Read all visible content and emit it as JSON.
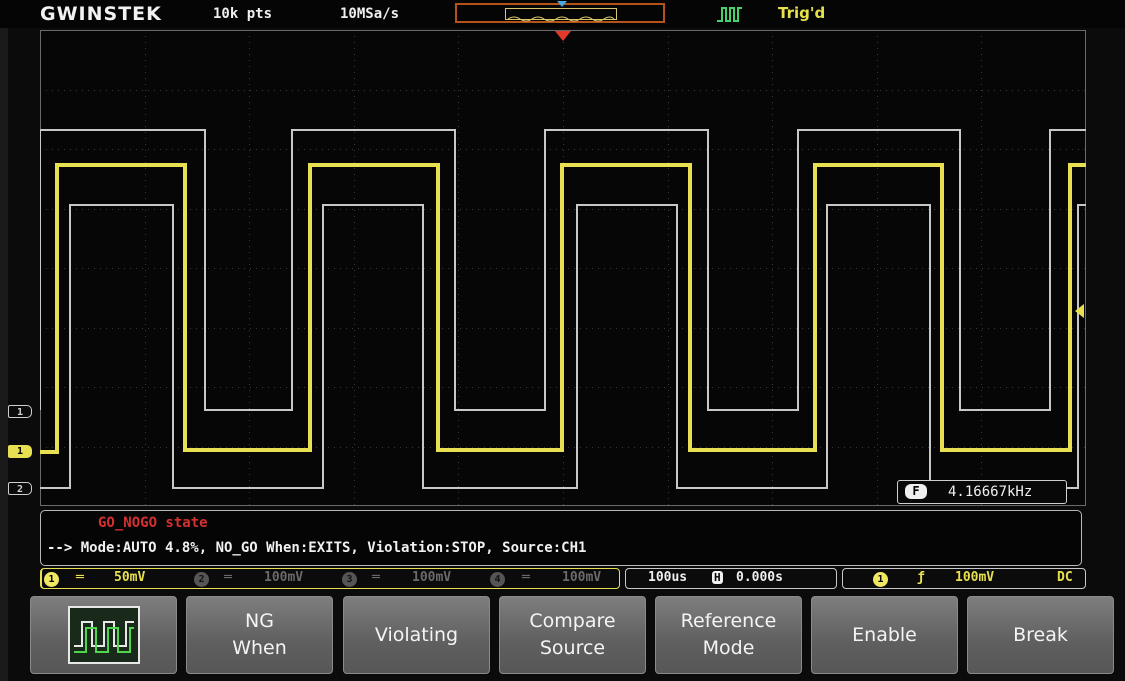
{
  "header": {
    "brand": "GWINSTEK",
    "record_length": "10k pts",
    "sample_rate": "10MSa/s",
    "trigger_status": "Trig'd"
  },
  "markers": {
    "ref1_label": "1",
    "ch1_label": "1",
    "ref2_label": "2"
  },
  "measurement": {
    "freq_icon": "F",
    "frequency": "4.16667kHz"
  },
  "message": {
    "title": "GO_NOGO state",
    "detail": "--> Mode:AUTO 4.8%, NO_GO When:EXITS, Violation:STOP, Source:CH1"
  },
  "status": {
    "ch1": {
      "num": "1",
      "coupling_symbol": "═",
      "scale": "50mV"
    },
    "ch2": {
      "num": "2",
      "coupling_symbol": "═",
      "scale": "100mV"
    },
    "ch3": {
      "num": "3",
      "coupling_symbol": "═",
      "scale": "100mV"
    },
    "ch4": {
      "num": "4",
      "coupling_symbol": "═",
      "scale": "100mV"
    },
    "timebase": "100us",
    "h_icon": "H",
    "h_position": "0.000s",
    "trigger_source": "1",
    "trigger_slope": "ƒ",
    "trigger_level": "100mV",
    "trigger_coupling": "DC"
  },
  "softkeys": [
    {
      "label": ""
    },
    {
      "label": "NG\nWhen"
    },
    {
      "label": "Violating"
    },
    {
      "label": "Compare\nSource"
    },
    {
      "label": "Reference\nMode"
    },
    {
      "label": "Enable"
    },
    {
      "label": "Break"
    }
  ],
  "colors": {
    "ch1": "#e8e050",
    "ref": "#c8c8c8",
    "trigger_marker": "#e23a2a",
    "message_title": "#d63030"
  }
}
